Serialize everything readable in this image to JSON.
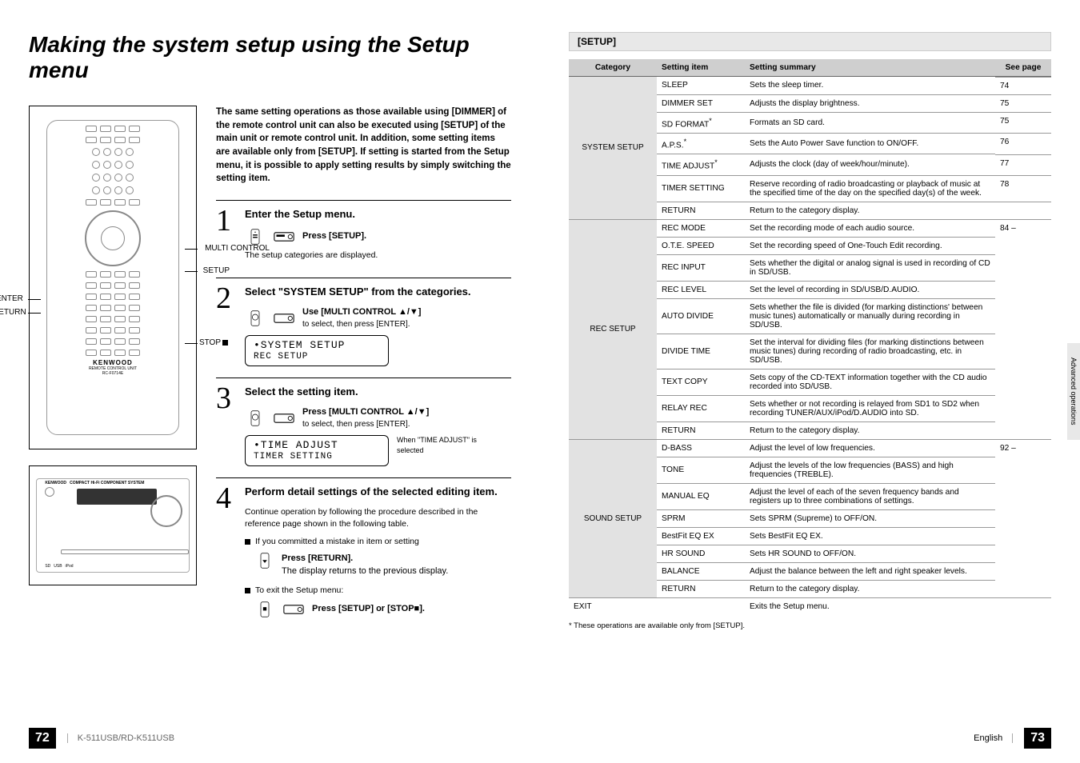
{
  "left": {
    "title": "Making the system setup using the Setup menu",
    "remote_labels": {
      "enter": "ENTER",
      "return": "RETURN",
      "multi": "MULTI CONTROL",
      "setup": "SETUP",
      "stop": "STOP"
    },
    "remote_brand": "KENWOOD",
    "remote_model_line1": "REMOTE CONTROL UNIT",
    "remote_model_line2": "RC-F0714E",
    "intro": "The same setting operations as those available using [DIMMER] of the remote control unit can also be executed using [SETUP] of the main unit or remote control unit. In addition, some setting items are available only from [SETUP]. If setting is started from the Setup menu, it is possible to apply setting results by simply switching the setting item.",
    "steps": {
      "s1": {
        "num": "1",
        "title": "Enter the Setup menu.",
        "press": "Press [SETUP].",
        "sub": "The setup categories are displayed."
      },
      "s2": {
        "num": "2",
        "title": "Select \"SYSTEM SETUP\" from the categories.",
        "press1": "Use [MULTI CONTROL ▲/▼]",
        "press2": "to select, then press [ENTER].",
        "lcd1": "•SYSTEM SETUP",
        "lcd2": " REC SETUP"
      },
      "s3": {
        "num": "3",
        "title": "Select the setting item.",
        "press1": "Press [MULTI CONTROL ▲/▼]",
        "press2": "to select, then press [ENTER].",
        "lcd1": "•TIME ADJUST",
        "lcd2": " TIMER SETTING",
        "note": "When \"TIME ADJUST\" is selected"
      },
      "s4": {
        "num": "4",
        "title": "Perform detail settings of the selected editing item.",
        "sub": "Continue operation by following the procedure described in the reference page shown in the following table.",
        "mistake": "If you committed a mistake in item or setting",
        "press_return": "Press [RETURN].",
        "return_sub": "The display returns to the previous display.",
        "exit": "To exit the Setup menu:",
        "press_exit": "Press [SETUP] or [STOP■]."
      }
    },
    "footer": {
      "page": "72",
      "model": "K-511USB/RD-K511USB"
    }
  },
  "right": {
    "section": "[SETUP]",
    "headers": {
      "cat": "Category",
      "item": "Setting item",
      "summary": "Setting summary",
      "page": "See page"
    },
    "categories": [
      {
        "name": "SYSTEM SETUP",
        "page_span_note": "",
        "rows": [
          {
            "item": "SLEEP",
            "summary": "Sets the sleep timer.",
            "page": "74"
          },
          {
            "item": "DIMMER SET",
            "summary": "Adjusts the display brightness.",
            "page": "75"
          },
          {
            "item": "SD FORMAT",
            "ast": true,
            "summary": "Formats an SD card.",
            "page": "75"
          },
          {
            "item": "A.P.S.",
            "ast": true,
            "summary": "Sets the Auto Power Save function to ON/OFF.",
            "page": "76"
          },
          {
            "item": "TIME ADJUST",
            "ast": true,
            "summary": "Adjusts the clock (day of week/hour/minute).",
            "page": "77"
          },
          {
            "item": "TIMER SETTING",
            "summary": "Reserve recording of radio broadcasting or playback of music at the specified time of the day on the specified day(s) of the week.",
            "page": "78"
          },
          {
            "item": "RETURN",
            "summary": "Return to the category display.",
            "page": ""
          }
        ]
      },
      {
        "name": "REC SETUP",
        "page_label": "84 –",
        "rows": [
          {
            "item": "REC MODE",
            "summary": "Set the recording mode of each audio source."
          },
          {
            "item": "O.T.E. SPEED",
            "summary": "Set the recording speed of One-Touch Edit recording."
          },
          {
            "item": "REC INPUT",
            "summary": "Sets whether the digital or analog signal is used in recording of CD in SD/USB."
          },
          {
            "item": "REC LEVEL",
            "summary": "Set the level of recording in SD/USB/D.AUDIO."
          },
          {
            "item": "AUTO DIVIDE",
            "summary": "Sets whether the file is divided (for marking distinctions' between music tunes) automatically or manually during recording in SD/USB."
          },
          {
            "item": "DIVIDE TIME",
            "summary": "Set the interval for dividing files (for marking distinctions between music tunes) during recording of radio broadcasting, etc. in SD/USB."
          },
          {
            "item": "TEXT COPY",
            "summary": "Sets copy of the CD-TEXT information together with the CD audio recorded into SD/USB."
          },
          {
            "item": "RELAY REC",
            "summary": "Sets whether or not recording is relayed from SD1 to SD2 when recording TUNER/AUX/iPod/D.AUDIO into SD."
          },
          {
            "item": "RETURN",
            "summary": "Return to the category display."
          }
        ]
      },
      {
        "name": "SOUND SETUP",
        "page_label": "92 –",
        "rows": [
          {
            "item": "D-BASS",
            "summary": "Adjust the level of low frequencies."
          },
          {
            "item": "TONE",
            "summary": "Adjust the levels of the low frequencies (BASS) and high frequencies (TREBLE)."
          },
          {
            "item": "MANUAL EQ",
            "summary": "Adjust the level of each of the seven frequency bands and registers up to three combinations of settings."
          },
          {
            "item": "SPRM",
            "summary": "Sets SPRM (Supreme) to OFF/ON."
          },
          {
            "item": "BestFit EQ EX",
            "summary": "Sets BestFit EQ EX."
          },
          {
            "item": "HR SOUND",
            "summary": "Sets HR SOUND to OFF/ON."
          },
          {
            "item": "BALANCE",
            "summary": "Adjust the balance between the left and right speaker levels."
          },
          {
            "item": "RETURN",
            "summary": "Return to the category display."
          }
        ]
      }
    ],
    "exit_row": {
      "item": "EXIT",
      "summary": "Exits the Setup menu."
    },
    "footnote": "* These operations are available only from [SETUP].",
    "side_tab": "Advanced operations",
    "footer": {
      "lang": "English",
      "page": "73"
    }
  }
}
